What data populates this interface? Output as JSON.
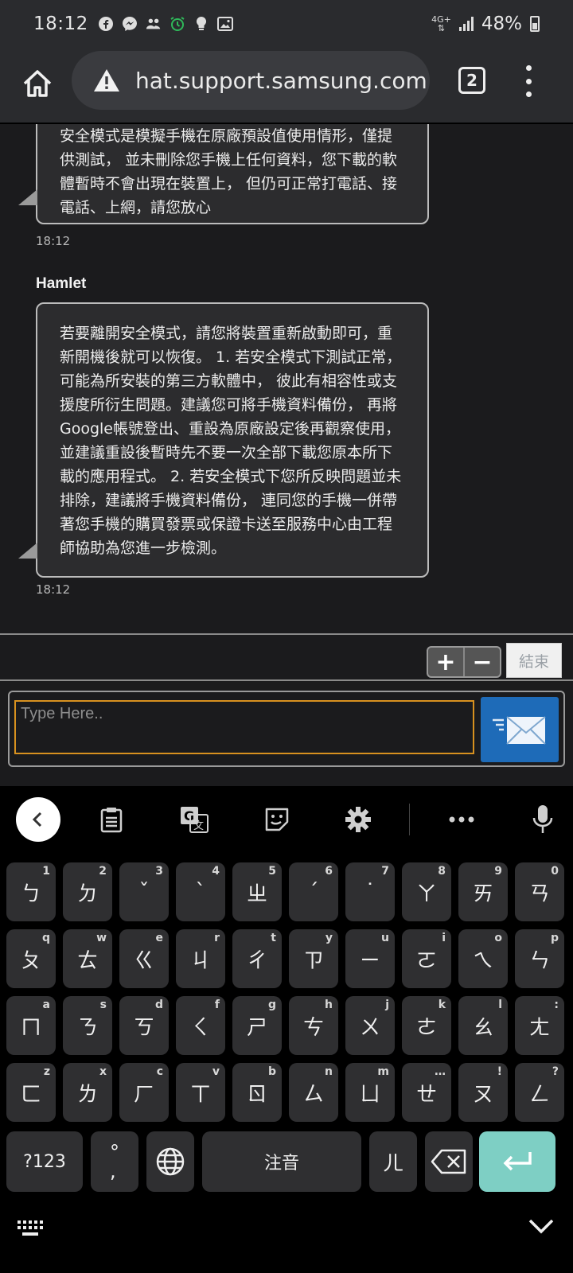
{
  "status_bar": {
    "time": "18:12",
    "network": "4G+",
    "battery": "48%",
    "notification_icons": [
      "facebook-icon",
      "messenger-icon",
      "people-icon",
      "alarm-icon",
      "bulb-icon",
      "image-icon"
    ]
  },
  "browser": {
    "url": "hat.support.samsung.com",
    "tab_count": "2"
  },
  "chat": {
    "messages": [
      {
        "text": "安全模式是模擬手機在原廠預設值使用情形，僅提供測試， 並未刪除您手機上任何資料，您下載的軟體暫時不會出現在裝置上， 但仍可正常打電話、接電話、上網，請您放心",
        "time": "18:12"
      },
      {
        "sender": "Hamlet",
        "text": "若要離開安全模式，請您將裝置重新啟動即可，重新開機後就可以恢復。 1. 若安全模式下測試正常，可能為所安裝的第三方軟體中， 彼此有相容性或支援度所衍生問題。建議您可將手機資料備份， 再將Google帳號登出、重設為原廠設定後再觀察使用， 並建議重設後暫時先不要一次全部下載您原本所下載的應用程式。 2. 若安全模式下您所反映問題並未排除，建議將手機資料備份， 連同您的手機一併帶著您手機的購買發票或保證卡送至服務中心由工程師協助為您進一步檢測。",
        "time": "18:12"
      }
    ],
    "zoom_in": "+",
    "zoom_out": "−",
    "end_label": "結束",
    "input_placeholder": "Type Here.."
  },
  "keyboard": {
    "rows": [
      [
        {
          "k": "ㄅ",
          "h": "1"
        },
        {
          "k": "ㄉ",
          "h": "2"
        },
        {
          "k": "ˇ",
          "h": "3"
        },
        {
          "k": "ˋ",
          "h": "4"
        },
        {
          "k": "ㄓ",
          "h": "5"
        },
        {
          "k": "ˊ",
          "h": "6"
        },
        {
          "k": "˙",
          "h": "7"
        },
        {
          "k": "ㄚ",
          "h": "8"
        },
        {
          "k": "ㄞ",
          "h": "9"
        },
        {
          "k": "ㄢ",
          "h": "0"
        }
      ],
      [
        {
          "k": "ㄆ",
          "h": "q"
        },
        {
          "k": "ㄊ",
          "h": "w"
        },
        {
          "k": "ㄍ",
          "h": "e"
        },
        {
          "k": "ㄐ",
          "h": "r"
        },
        {
          "k": "ㄔ",
          "h": "t"
        },
        {
          "k": "ㄗ",
          "h": "y"
        },
        {
          "k": "ㄧ",
          "h": "u"
        },
        {
          "k": "ㄛ",
          "h": "i"
        },
        {
          "k": "ㄟ",
          "h": "o"
        },
        {
          "k": "ㄣ",
          "h": "p"
        }
      ],
      [
        {
          "k": "ㄇ",
          "h": "a"
        },
        {
          "k": "ㄋ",
          "h": "s"
        },
        {
          "k": "ㄎ",
          "h": "d"
        },
        {
          "k": "ㄑ",
          "h": "f"
        },
        {
          "k": "ㄕ",
          "h": "g"
        },
        {
          "k": "ㄘ",
          "h": "h"
        },
        {
          "k": "ㄨ",
          "h": "j"
        },
        {
          "k": "ㄜ",
          "h": "k"
        },
        {
          "k": "ㄠ",
          "h": "l"
        },
        {
          "k": "ㄤ",
          "h": ":"
        }
      ],
      [
        {
          "k": "ㄈ",
          "h": "z"
        },
        {
          "k": "ㄌ",
          "h": "x"
        },
        {
          "k": "ㄏ",
          "h": "c"
        },
        {
          "k": "ㄒ",
          "h": "v"
        },
        {
          "k": "ㄖ",
          "h": "b"
        },
        {
          "k": "ㄙ",
          "h": "n"
        },
        {
          "k": "ㄩ",
          "h": "m"
        },
        {
          "k": "ㄝ",
          "h": "…"
        },
        {
          "k": "ㄡ",
          "h": "!"
        },
        {
          "k": "ㄥ",
          "h": "?"
        }
      ]
    ],
    "symbols_label": "?123",
    "punct_label": "°\n,",
    "space_label": "注音",
    "er_label": "ㄦ"
  }
}
